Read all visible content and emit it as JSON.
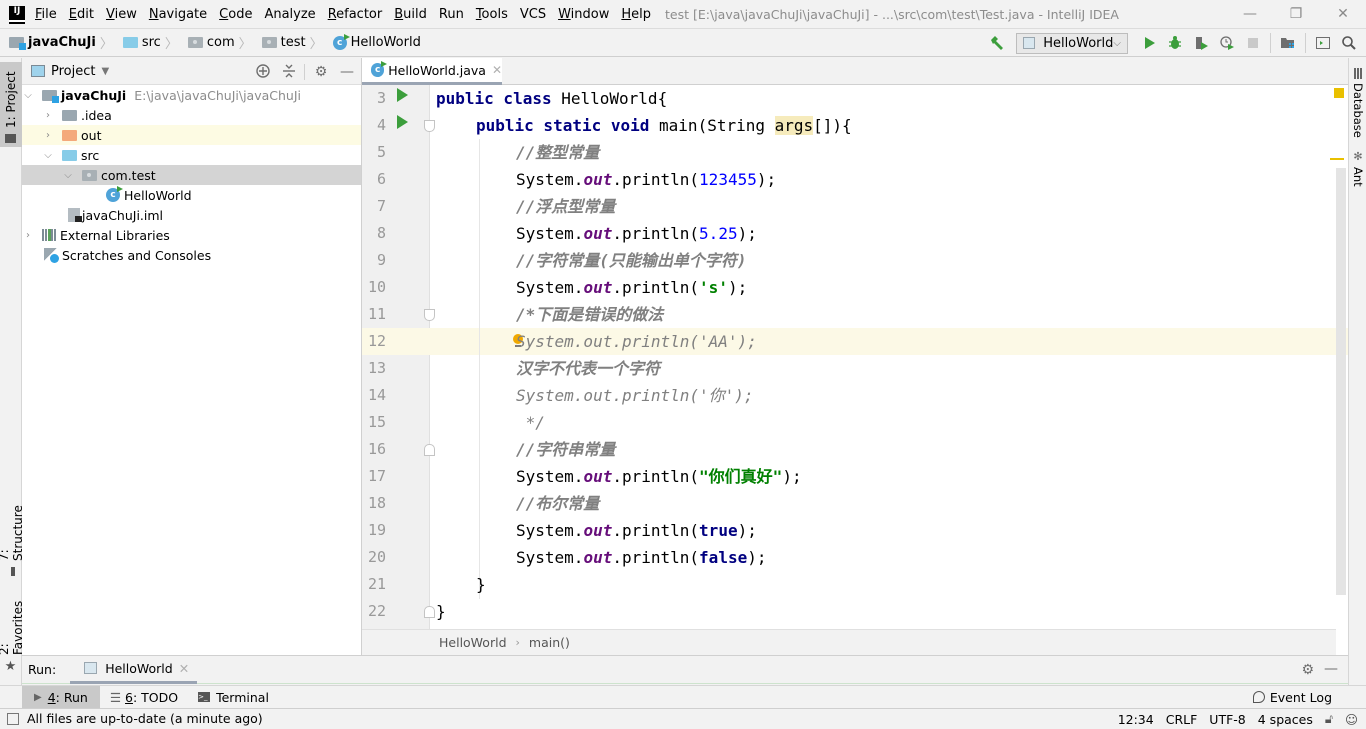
{
  "window": {
    "title": "test [E:\\java\\javaChuJi\\javaChuJi] - ...\\src\\com\\test\\Test.java - IntelliJ IDEA",
    "logo": "IJ",
    "controls": {
      "minimize": "—",
      "restore": "❐",
      "close": "✕"
    }
  },
  "menu": [
    {
      "label": "File"
    },
    {
      "label": "Edit"
    },
    {
      "label": "View"
    },
    {
      "label": "Navigate"
    },
    {
      "label": "Code"
    },
    {
      "label": "Analyze"
    },
    {
      "label": "Refactor"
    },
    {
      "label": "Build"
    },
    {
      "label": "Run"
    },
    {
      "label": "Tools"
    },
    {
      "label": "VCS"
    },
    {
      "label": "Window"
    },
    {
      "label": "Help"
    }
  ],
  "breadcrumb": [
    {
      "label": "javaChuJi",
      "icon": "module-folder-icon"
    },
    {
      "label": "src",
      "icon": "source-folder-icon"
    },
    {
      "label": "com",
      "icon": "package-icon"
    },
    {
      "label": "test",
      "icon": "package-icon"
    },
    {
      "label": "HelloWorld",
      "icon": "java-class-icon"
    }
  ],
  "toolbar": {
    "run_config": "HelloWorld",
    "build_icon": "hammer-icon",
    "run_icon": "run-icon",
    "debug_icon": "debug-icon",
    "coverage_icon": "coverage-icon",
    "profile_icon": "profile-icon",
    "stop_icon": "stop-icon",
    "project_structure_icon": "project-structure-icon",
    "terminal_icon": "terminal-icon",
    "search_icon": "search-icon"
  },
  "left_strip": {
    "project": "1: Project",
    "structure": "7: Structure",
    "favorites": "2: Favorites"
  },
  "right_strip": {
    "database": "Database",
    "ant": "Ant"
  },
  "project_panel": {
    "title": "Project",
    "tree": [
      {
        "label": "javaChuJi",
        "hint": "E:\\java\\javaChuJi\\javaChuJi",
        "expanded": true
      },
      {
        "label": ".idea",
        "expanded": false
      },
      {
        "label": "out",
        "expanded": false
      },
      {
        "label": "src",
        "expanded": true
      },
      {
        "label": "com.test",
        "expanded": true,
        "selected": true
      },
      {
        "label": "HelloWorld"
      },
      {
        "label": "javaChuJi.iml"
      },
      {
        "label": "External Libraries",
        "expanded": false
      },
      {
        "label": "Scratches and Consoles"
      }
    ]
  },
  "editor": {
    "tab": "HelloWorld.java",
    "current_line": 12,
    "line_numbers": [
      "3",
      "4",
      "5",
      "6",
      "7",
      "8",
      "9",
      "10",
      "11",
      "12",
      "13",
      "14",
      "15",
      "16",
      "17",
      "18",
      "19",
      "20",
      "21",
      "22"
    ],
    "code": {
      "l3": {
        "kw": "public class ",
        "rest": "HelloWorld{"
      },
      "l4": {
        "kw": "public static void ",
        "pre": "main(String ",
        "param": "args",
        "post": "[]){"
      },
      "l5": {
        "comment": "//整型常量"
      },
      "l6": {
        "obj": "System.",
        "field": "out",
        "call": ".println(",
        "arg": "123455",
        "end": ");"
      },
      "l7": {
        "comment": "//浮点型常量"
      },
      "l8": {
        "obj": "System.",
        "field": "out",
        "call": ".println(",
        "arg": "5.25",
        "end": ");"
      },
      "l9": {
        "comment": "//字符常量(只能输出单个字符)"
      },
      "l10": {
        "obj": "System.",
        "field": "out",
        "call": ".println(",
        "arg": "'s'",
        "end": ");"
      },
      "l11": {
        "comment": "/*下面是错误的做法"
      },
      "l12": {
        "comment": "System.out.println('AA');"
      },
      "l13": {
        "comment": "汉字不代表一个字符"
      },
      "l14": {
        "comment": "System.out.println('你');"
      },
      "l15": {
        "comment": " */"
      },
      "l16": {
        "comment": "//字符串常量"
      },
      "l17": {
        "obj": "System.",
        "field": "out",
        "call": ".println(",
        "arg": "\"你们真好\"",
        "end": ");"
      },
      "l18": {
        "comment": "//布尔常量"
      },
      "l19": {
        "obj": "System.",
        "field": "out",
        "call": ".println(",
        "arg": "true",
        "end": ");"
      },
      "l20": {
        "obj": "System.",
        "field": "out",
        "call": ".println(",
        "arg": "false",
        "end": ");"
      },
      "l21": {
        "text": "}"
      },
      "l22": {
        "text": "}"
      }
    },
    "breadcrumb": [
      "HelloWorld",
      "main()"
    ]
  },
  "run_window": {
    "label": "Run:",
    "tab": "HelloWorld"
  },
  "bottom_tools": [
    {
      "key": "4",
      "label": ": Run"
    },
    {
      "key": "6",
      "label": ": TODO"
    },
    {
      "label": "Terminal"
    },
    {
      "label": "Event Log"
    }
  ],
  "status": {
    "message": "All files are up-to-date (a minute ago)",
    "position": "12:34",
    "line_separator": "CRLF",
    "encoding": "UTF-8",
    "indent": "4 spaces"
  },
  "colors": {
    "keyword": "#000080",
    "number": "#0000ff",
    "string": "#008000",
    "field": "#660e7a",
    "comment": "#808080",
    "run_green": "#3c9e3c",
    "current_line": "#fcf9e6"
  }
}
